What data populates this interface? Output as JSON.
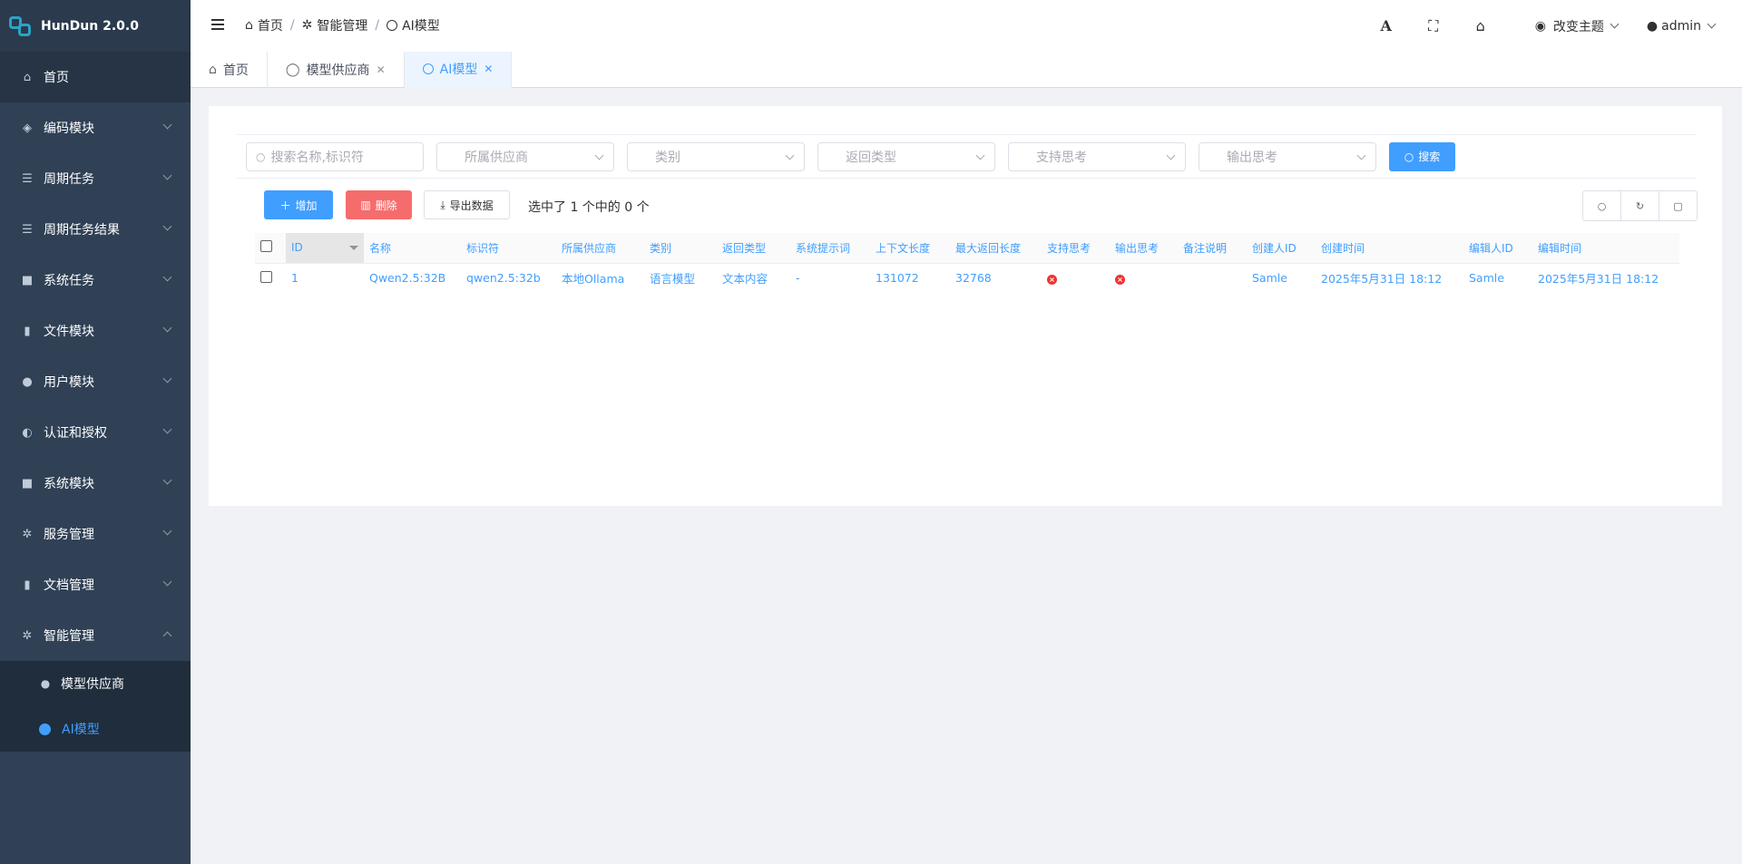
{
  "app": {
    "title": "HunDun 2.0.0"
  },
  "sidebar": {
    "items": [
      {
        "label": "首页",
        "icon": "home-icon"
      },
      {
        "label": "编码模块",
        "icon": "cube-icon"
      },
      {
        "label": "周期任务",
        "icon": "list-icon"
      },
      {
        "label": "周期任务结果",
        "icon": "list-icon"
      },
      {
        "label": "系统任务",
        "icon": "square-icon"
      },
      {
        "label": "文件模块",
        "icon": "file-icon"
      },
      {
        "label": "用户模块",
        "icon": "user-icon"
      },
      {
        "label": "认证和授权",
        "icon": "shield-icon"
      },
      {
        "label": "系统模块",
        "icon": "square-icon"
      },
      {
        "label": "服务管理",
        "icon": "gear-icon"
      },
      {
        "label": "文档管理",
        "icon": "file-icon"
      },
      {
        "label": "智能管理",
        "icon": "gear-icon"
      }
    ],
    "submenu": [
      {
        "label": "模型供应商",
        "icon": "user-icon"
      },
      {
        "label": "AI模型",
        "icon": "dot-icon",
        "active": true
      }
    ]
  },
  "navbar": {
    "breadcrumb": [
      "首页",
      "智能管理",
      "AI模型"
    ],
    "theme_label": "改变主题",
    "user_label": "admin"
  },
  "tabs": [
    {
      "label": "首页"
    },
    {
      "label": "模型供应商"
    },
    {
      "label": "AI模型",
      "active": true
    }
  ],
  "filters": {
    "search_placeholder": "搜索名称,标识符",
    "provider_placeholder": "所属供应商",
    "category_placeholder": "类别",
    "return_type_placeholder": "返回类型",
    "support_thinking_placeholder": "支持思考",
    "output_thinking_placeholder": "输出思考",
    "search_button": "搜索"
  },
  "toolbar": {
    "add_label": "增加",
    "delete_label": "删除",
    "export_label": "导出数据",
    "selection_info": "选中了 1 个中的 0 个"
  },
  "table": {
    "columns": [
      "ID",
      "名称",
      "标识符",
      "所属供应商",
      "类别",
      "返回类型",
      "系统提示词",
      "上下文长度",
      "最大返回长度",
      "支持思考",
      "输出思考",
      "备注说明",
      "创建人ID",
      "创建时间",
      "编辑人ID",
      "编辑时间"
    ],
    "rows": [
      [
        "1",
        "Qwen2.5:32B",
        "qwen2.5:32b",
        "本地Ollama",
        "语言模型",
        "文本内容",
        "-",
        "131072",
        "32768",
        "×",
        "×",
        "",
        "Samle",
        "2025年5月31日 18:12",
        "Samle",
        "2025年5月31日 18:12"
      ]
    ]
  },
  "colors": {
    "sidebar_bg": "#304156",
    "accent": "#409eff",
    "danger": "#f56c6c"
  }
}
